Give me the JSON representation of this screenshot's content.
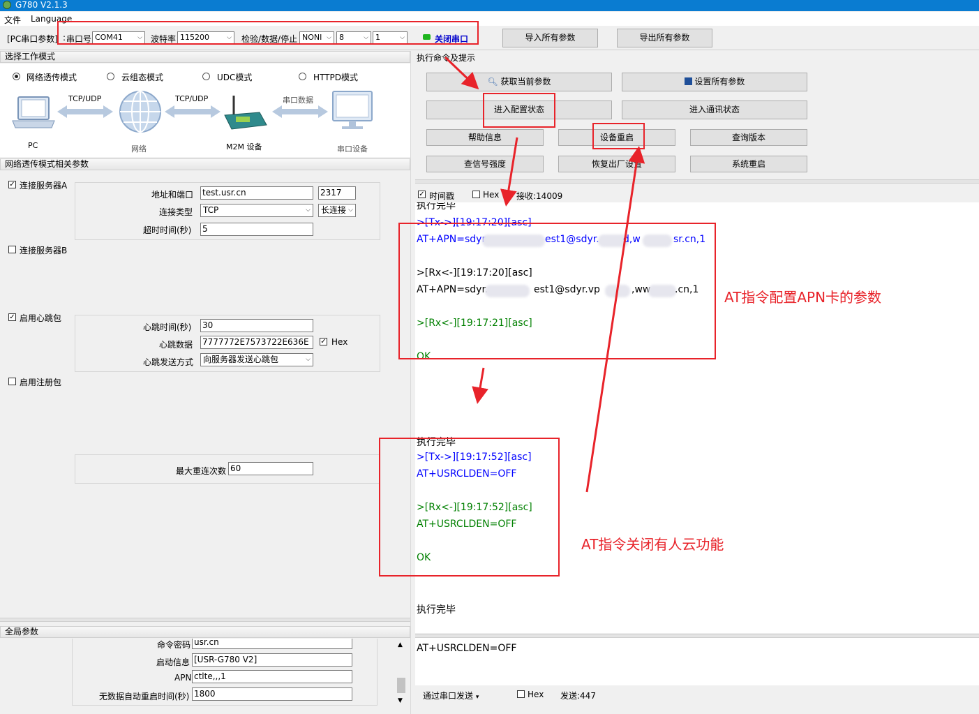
{
  "window": {
    "title": "G780 V2.1.3"
  },
  "menu": {
    "file": "文件",
    "language": "Language"
  },
  "serial": {
    "group_label": "[PC串口参数]",
    "port_label": "串口号",
    "port_value": "COM41",
    "baud_label": "波特率",
    "baud_value": "115200",
    "format_label": "检验/数据/停止",
    "parity_value": "NONI",
    "databits_value": "8",
    "stopbits_value": "1",
    "toggle_label": "关闭串口",
    "import_label": "导入所有参数",
    "export_label": "导出所有参数"
  },
  "mode": {
    "section_title": "选择工作模式",
    "options": [
      "网络透传模式",
      "云组态模式",
      "UDC模式",
      "HTTPD模式"
    ],
    "selected_index": 0,
    "diagram": {
      "pc": "PC",
      "link1": "TCP/UDP",
      "net": "网络",
      "link2": "TCP/UDP",
      "m2m": "M2M 设备",
      "link3": "串口数据",
      "serial_dev": "串口设备"
    }
  },
  "params": {
    "section_title": "网络透传模式相关参数",
    "serverA": {
      "label": "连接服务器A",
      "checked": true,
      "addr_label": "地址和端口",
      "addr_value": "test.usr.cn",
      "port_value": "2317",
      "type_label": "连接类型",
      "type_value": "TCP",
      "type_mode": "长连接",
      "timeout_label": "超时时间(秒)",
      "timeout_value": "5"
    },
    "serverB": {
      "label": "连接服务器B",
      "checked": false
    },
    "heartbeat": {
      "label": "启用心跳包",
      "checked": true,
      "time_label": "心跳时间(秒)",
      "time_value": "30",
      "data_label": "心跳数据",
      "data_value": "7777772E7573722E636E",
      "hex_label": "Hex",
      "mode_label": "心跳发送方式",
      "mode_value": "向服务器发送心跳包"
    },
    "register": {
      "label": "启用注册包",
      "checked": false
    },
    "retry_label": "最大重连次数",
    "retry_value": "60"
  },
  "global": {
    "section_title": "全局参数",
    "pwd_label": "命令密码",
    "pwd_value": "usr.cn",
    "boot_label": "启动信息",
    "boot_value": "[USR-G780 V2]",
    "apn_label": "APN",
    "apn_value": "ctlte,,,1",
    "restart_label": "无数据自动重启时间(秒)",
    "restart_value": "1800"
  },
  "commands": {
    "section_title": "执行命令及提示",
    "get_params": "获取当前参数",
    "set_params": "设置所有参数",
    "enter_config": "进入配置状态",
    "enter_comm": "进入通讯状态",
    "help": "帮助信息",
    "reboot": "设备重启",
    "version": "查询版本",
    "signal": "查信号强度",
    "factory": "恢复出厂设置",
    "sys_restart": "系统重启"
  },
  "log": {
    "timestamp_label": "时间戳",
    "hex_label": "Hex",
    "recv_label": "接收:14009",
    "lines": {
      "l0": "执行完毕",
      "l1": ">[Tx->][19:17:20][asc]",
      "l2": "AT+APN=sdyr",
      "l2b": "est1@sdyr.",
      "l2c": "d,w",
      "l2d": "sr.cn,1",
      "l3": ">[Rx<-][19:17:20][asc]",
      "l4": "AT+APN=sdyr.",
      "l4b": "est1@sdyr.vp",
      "l4c": ",ww",
      "l4d": ".cn,1",
      "l5": ">[Rx<-][19:17:21][asc]",
      "l6": "OK",
      "l7": "执行完毕",
      "l8": ">[Tx->][19:17:52][asc]",
      "l9": "AT+USRCLDEN=OFF",
      "l10": ">[Rx<-][19:17:52][asc]",
      "l11": "AT+USRCLDEN=OFF",
      "l12": "OK",
      "l13": "执行完毕"
    }
  },
  "send": {
    "input_value": "AT+USRCLDEN=OFF",
    "via_label": "通过串口发送",
    "hex_label": "Hex",
    "sent_label": "发送:447"
  },
  "annotations": {
    "apn": "AT指令配置APN卡的参数",
    "cloud": "AT指令关闭有人云功能"
  },
  "colors": {
    "title_bar": "#0a7cd1",
    "tx": "#0000ff",
    "rx": "#008000",
    "annotation": "#e8232a"
  }
}
